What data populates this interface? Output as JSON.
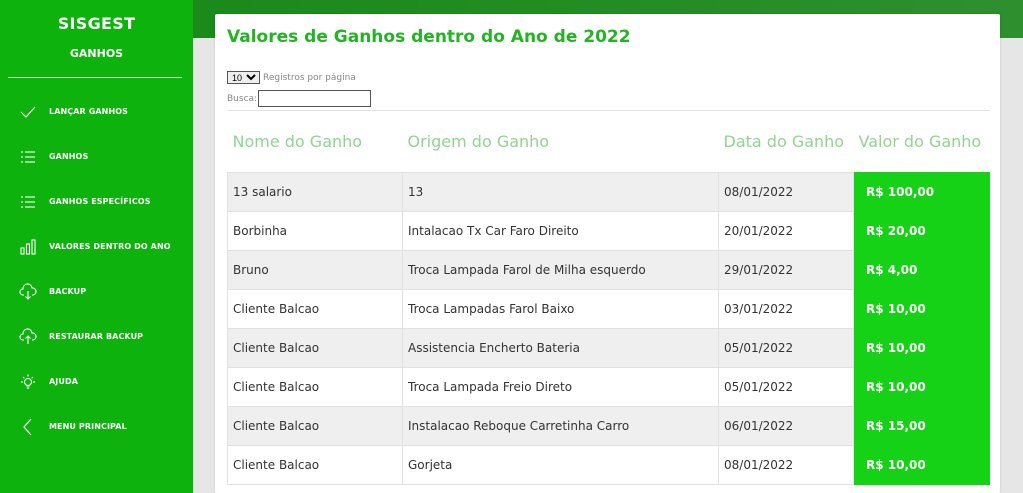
{
  "sidebar": {
    "brand": "SISGEST",
    "subtitle": "GANHOS",
    "items": [
      {
        "label": "LANÇAR GANHOS",
        "icon": "check-icon"
      },
      {
        "label": "GANHOS",
        "icon": "list-icon"
      },
      {
        "label": "GANHOS ESPECÍFICOS",
        "icon": "list-icon"
      },
      {
        "label": "VALORES DENTRO DO ANO",
        "icon": "bar-chart-icon"
      },
      {
        "label": "BACKUP",
        "icon": "cloud-download-icon"
      },
      {
        "label": "RESTAURAR BACKUP",
        "icon": "cloud-upload-icon"
      },
      {
        "label": "AJUDA",
        "icon": "lightbulb-icon"
      },
      {
        "label": "MENU PRINCIPAL",
        "icon": "chevron-left-icon"
      }
    ]
  },
  "main": {
    "title": "Valores de Ganhos dentro do Ano de 2022",
    "length_value": "10",
    "length_label": "Registros por página",
    "search_label": "Busca:",
    "search_value": "",
    "columns": [
      "Nome do Ganho",
      "Origem do Ganho",
      "Data do Ganho",
      "Valor do Ganho"
    ],
    "rows": [
      [
        "13 salario",
        "13",
        "08/01/2022",
        "R$ 100,00"
      ],
      [
        "Borbinha",
        "Intalacao Tx Car Faro Direito",
        "20/01/2022",
        "R$ 20,00"
      ],
      [
        "Bruno",
        "Troca Lampada Farol de Milha esquerdo",
        "29/01/2022",
        "R$ 4,00"
      ],
      [
        "Cliente Balcao",
        "Troca Lampadas Farol Baixo",
        "03/01/2022",
        "R$ 10,00"
      ],
      [
        "Cliente Balcao",
        "Assistencia Encherto Bateria",
        "05/01/2022",
        "R$ 10,00"
      ],
      [
        "Cliente Balcao",
        "Troca Lampada Freio Direto",
        "05/01/2022",
        "R$ 10,00"
      ],
      [
        "Cliente Balcao",
        "Instalacao Reboque Carretinha Carro",
        "06/01/2022",
        "R$ 15,00"
      ],
      [
        "Cliente Balcao",
        "Gorjeta",
        "08/01/2022",
        "R$ 10,00"
      ]
    ]
  },
  "colors": {
    "sidebar": "#0db20d",
    "accent": "#22b422",
    "value_cell": "#16d216"
  }
}
